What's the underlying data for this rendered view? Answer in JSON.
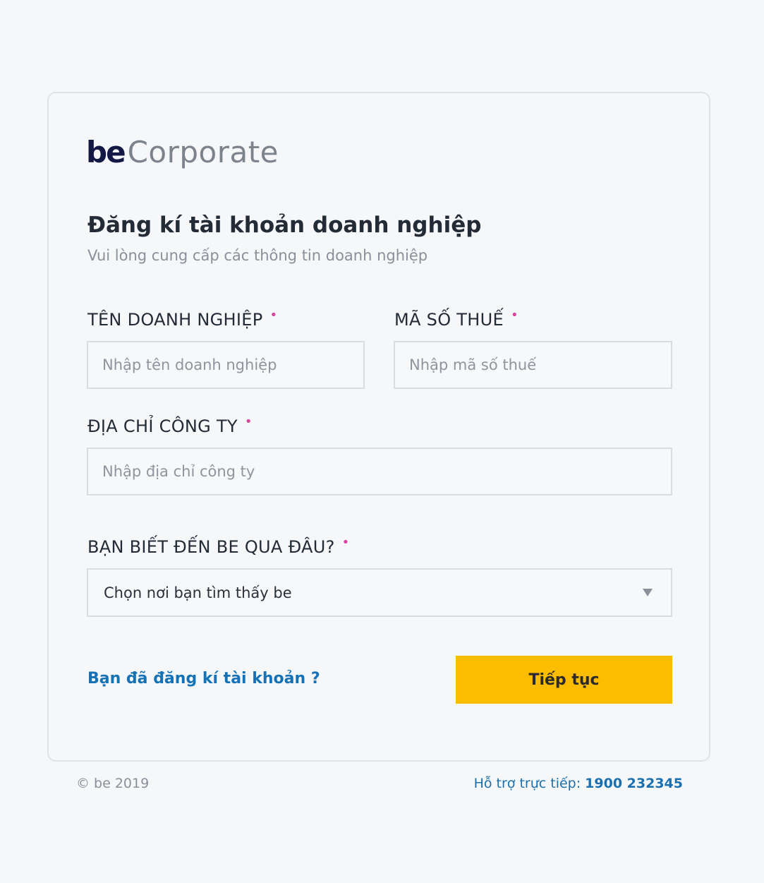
{
  "brand": {
    "logo_be": "be",
    "logo_suffix": "Corporate"
  },
  "form": {
    "title": "Đăng kí tài khoản doanh nghiệp",
    "subtitle": "Vui lòng cung cấp các thông tin doanh nghiệp",
    "required_marker": "•",
    "company_name": {
      "label": "TÊN DOANH NGHIỆP",
      "placeholder": "Nhập tên doanh nghiệp",
      "value": ""
    },
    "tax_code": {
      "label": "MÃ SỐ THUẾ",
      "placeholder": "Nhập mã số thuế",
      "value": ""
    },
    "company_address": {
      "label": "ĐỊA CHỈ CÔNG TY",
      "placeholder": "Nhập địa chỉ công ty",
      "value": ""
    },
    "referral_source": {
      "label": "BẠN BIẾT ĐẾN BE QUA ĐÂU?",
      "selected": "Chọn nơi bạn tìm thấy be",
      "icon": "chevron-down-icon"
    },
    "login_link": "Bạn đã đăng kí tài khoản ?",
    "continue_label": "Tiếp tục"
  },
  "footer": {
    "copyright": "© be 2019",
    "support_label": "Hỗ trợ trực tiếp:",
    "support_phone": "1900 232345"
  },
  "colors": {
    "background": "#f5f7f9",
    "brand_navy": "#141845",
    "accent_yellow": "#fcbc00",
    "link_blue": "#1572b6",
    "required_pink": "#d6449b"
  }
}
